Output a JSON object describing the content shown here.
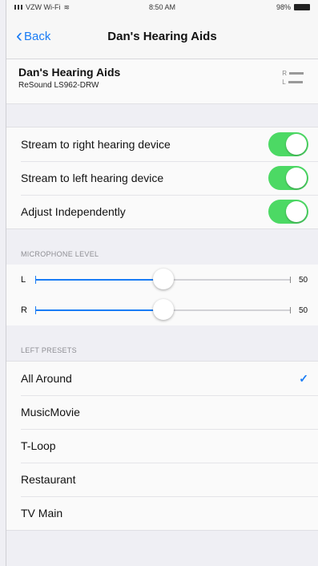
{
  "status": {
    "carrier": "VZW Wi-Fi",
    "time": "8:50 AM",
    "battery": "98%"
  },
  "nav": {
    "back_label": "Back",
    "title": "Dan's Hearing Aids"
  },
  "device": {
    "name": "Dan's Hearing Aids",
    "model": "ReSound LS962-DRW",
    "right_label": "R",
    "left_label": "L"
  },
  "toggles": [
    {
      "label": "Stream to right hearing device",
      "on": true
    },
    {
      "label": "Stream to left hearing device",
      "on": true
    },
    {
      "label": "Adjust Independently",
      "on": true
    }
  ],
  "microphone": {
    "header": "MICROPHONE LEVEL",
    "left": {
      "label": "L",
      "value": "50",
      "level": 0.5
    },
    "right": {
      "label": "R",
      "value": "50",
      "level": 0.5
    }
  },
  "presets": {
    "header": "LEFT PRESETS",
    "items": [
      {
        "label": "All Around",
        "selected": true
      },
      {
        "label": "MusicMovie",
        "selected": false
      },
      {
        "label": "T-Loop",
        "selected": false
      },
      {
        "label": "Restaurant",
        "selected": false
      },
      {
        "label": "TV Main",
        "selected": false
      }
    ],
    "check_glyph": "✓"
  },
  "colors": {
    "accent": "#1a7cf5",
    "switch_on": "#4cd964"
  }
}
